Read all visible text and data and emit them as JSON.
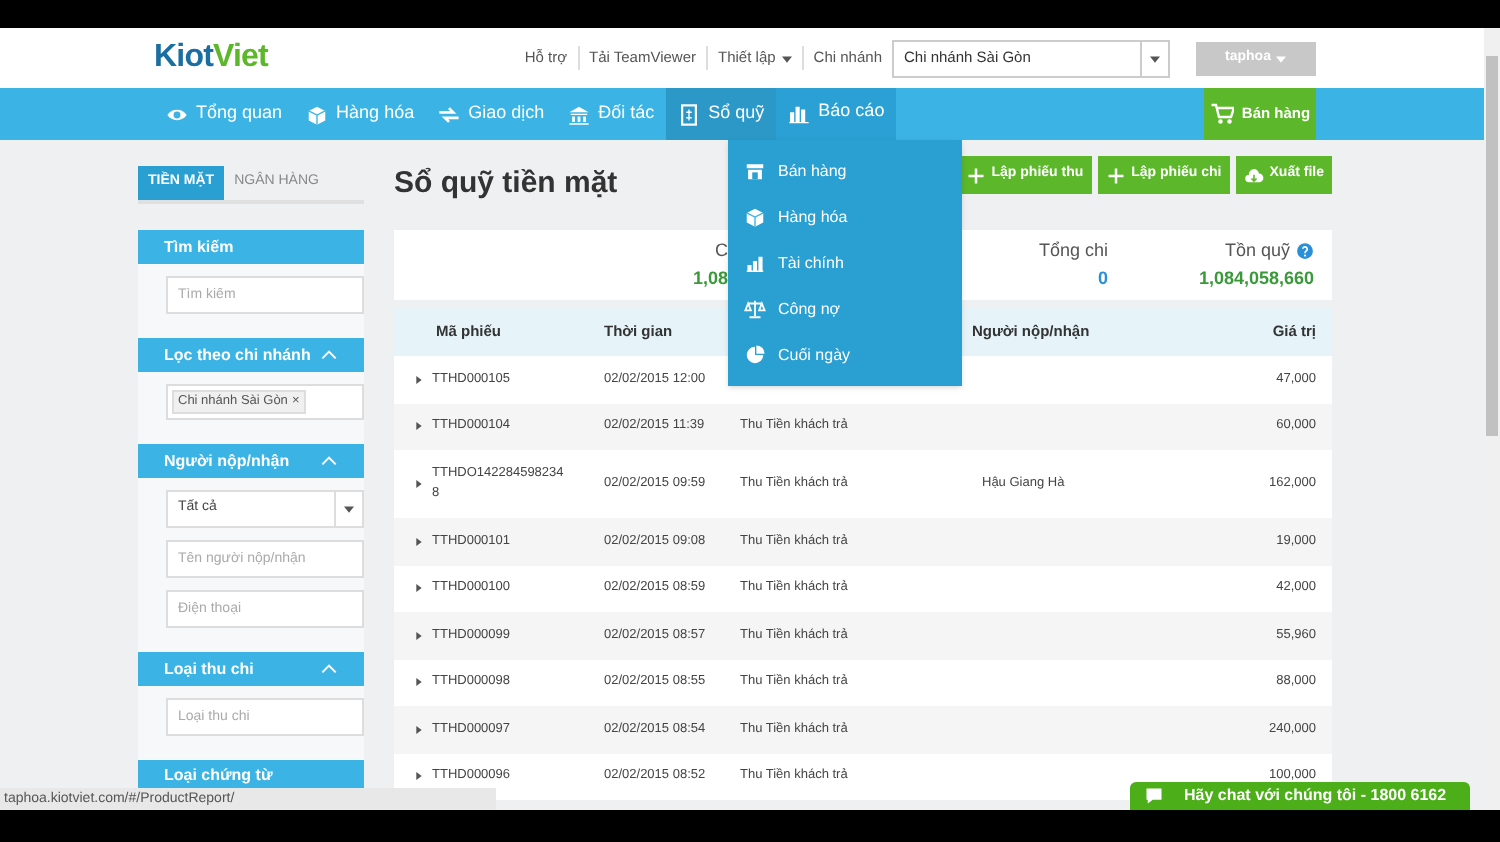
{
  "header": {
    "logo_part_1": "Kiot",
    "logo_part_2": "Viet",
    "links": [
      {
        "label": "Hỗ trợ",
        "caret": false
      },
      {
        "label": "Tải TeamViewer",
        "caret": false
      },
      {
        "label": "Thiết lập",
        "caret": true
      }
    ],
    "branch_label": "Chi nhánh",
    "branch_select": "Chi nhánh Sài Gòn",
    "user_button": "taphoa"
  },
  "nav": [
    {
      "label": "Tổng quan",
      "selected": false,
      "open": false
    },
    {
      "label": "Hàng hóa",
      "selected": false,
      "open": false
    },
    {
      "label": "Giao dịch",
      "selected": false,
      "open": false
    },
    {
      "label": "Đối tác",
      "selected": false,
      "open": false
    },
    {
      "label": "Sổ quỹ",
      "selected": true,
      "open": false
    },
    {
      "label": "Báo cáo",
      "selected": false,
      "open": true
    }
  ],
  "sell_button": "Bán hàng",
  "report_menu": [
    "Bán hàng",
    "Hàng hóa",
    "Tài chính",
    "Công nợ",
    "Cuối ngày"
  ],
  "sidebar": {
    "tabs": [
      {
        "label": "TIỀN MẶT",
        "selected": true
      },
      {
        "label": "NGÂN HÀNG",
        "selected": false
      }
    ],
    "sections": [
      {
        "title": "Tìm kiếm",
        "collapsible": false,
        "fields": [
          {
            "kind": "input",
            "placeholder": "Tìm kiếm"
          }
        ]
      },
      {
        "title": "Lọc theo chi nhánh",
        "collapsible": true,
        "fields": [
          {
            "kind": "tag",
            "value": "Chi nhánh Sài Gòn",
            "remove": "×"
          }
        ]
      },
      {
        "title": "Người nộp/nhận",
        "collapsible": true,
        "fields": [
          {
            "kind": "select",
            "value": "Tất cả"
          },
          {
            "kind": "input",
            "placeholder": "Tên người nộp/nhận"
          },
          {
            "kind": "input",
            "placeholder": "Điện thoại"
          }
        ]
      },
      {
        "title": "Loại thu chi",
        "collapsible": true,
        "fields": [
          {
            "kind": "input",
            "placeholder": "Loại thu chi"
          }
        ]
      },
      {
        "title": "Loại chứng từ",
        "collapsible": false
      }
    ]
  },
  "page_title": "Sổ quỹ tiền mặt",
  "actions": [
    "Lập phiếu thu",
    "Lập phiếu chi",
    "Xuất file"
  ],
  "summary": [
    {
      "label": "C",
      "value": "1,08",
      "help": false
    },
    {
      "label": "Tổng chi",
      "value": "0",
      "help": false
    },
    {
      "label": "Tồn quỹ",
      "value": "1,084,058,660",
      "help": true
    }
  ],
  "table": {
    "columns": [
      "Mã phiếu",
      "Thời gian",
      "Người nộp/nhận",
      "Giá trị"
    ],
    "rows": [
      {
        "code": "TTHD000105",
        "time": "02/02/2015 12:00",
        "value": "47,000"
      },
      {
        "code": "TTHD000104",
        "time": "02/02/2015 11:39",
        "type": "Thu Tiền khách trả",
        "value": "60,000"
      },
      {
        "code": "TTHDO1422845982348",
        "time": "02/02/2015 09:59",
        "type": "Thu Tiền khách trả",
        "person": "Hậu Giang Hà",
        "value": "162,000"
      },
      {
        "code": "TTHD000101",
        "time": "02/02/2015 09:08",
        "type": "Thu Tiền khách trả",
        "value": "19,000"
      },
      {
        "code": "TTHD000100",
        "time": "02/02/2015 08:59",
        "type": "Thu Tiền khách trả",
        "value": "42,000"
      },
      {
        "code": "TTHD000099",
        "time": "02/02/2015 08:57",
        "type": "Thu Tiền khách trả",
        "value": "55,960"
      },
      {
        "code": "TTHD000098",
        "time": "02/02/2015 08:55",
        "type": "Thu Tiền khách trả",
        "value": "88,000"
      },
      {
        "code": "TTHD000097",
        "time": "02/02/2015 08:54",
        "type": "Thu Tiền khách trả",
        "value": "240,000"
      },
      {
        "code": "TTHD000096",
        "time": "02/02/2015 08:52",
        "type": "Thu Tiền khách trả",
        "value": "100,000"
      }
    ]
  },
  "status_url": "taphoa.kiotviet.com/#/ProductReport/",
  "chat_button": "Hãy chat với chúng tôi - 1800 6162"
}
